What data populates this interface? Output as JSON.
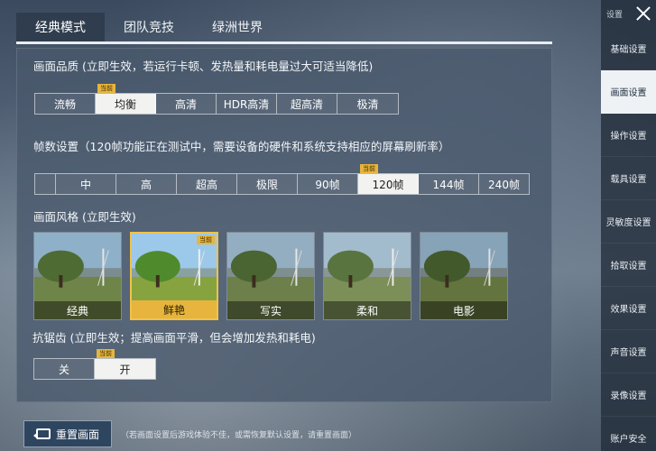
{
  "top_tabs": [
    "经典模式",
    "团队竞技",
    "绿洲世界"
  ],
  "tag_current": "当前",
  "quality": {
    "title": "画面品质 (立即生效，若运行卡顿、发热量和耗电量过大可适当降低)",
    "options": [
      "流畅",
      "均衡",
      "高清",
      "HDR高清",
      "超高清",
      "极清"
    ],
    "selected": "均衡"
  },
  "fps": {
    "title": "帧数设置（120帧功能正在测试中，需要设备的硬件和系统支持相应的屏幕刷新率）",
    "options": [
      "",
      "中",
      "高",
      "超高",
      "极限",
      "90帧",
      "120帧",
      "144帧",
      "240帧"
    ],
    "selected": "120帧"
  },
  "style": {
    "title": "画面风格 (立即生效)",
    "options": [
      "经典",
      "鲜艳",
      "写实",
      "柔和",
      "电影"
    ],
    "selected": "鲜艳"
  },
  "antialias": {
    "title": "抗锯齿 (立即生效；提高画面平滑，但会增加发热和耗电)",
    "options": [
      "关",
      "开"
    ],
    "selected": "开"
  },
  "sidebar": {
    "header": "设置",
    "items": [
      "基础设置",
      "画面设置",
      "操作设置",
      "载具设置",
      "灵敏度设置",
      "拾取设置",
      "效果设置",
      "声音设置",
      "录像设置",
      "账户安全"
    ],
    "active": "画面设置"
  },
  "reset": {
    "label": "重置画面",
    "hint": "（若画面设置后游戏体验不佳，或需恢复默认设置，请重置画面）"
  }
}
